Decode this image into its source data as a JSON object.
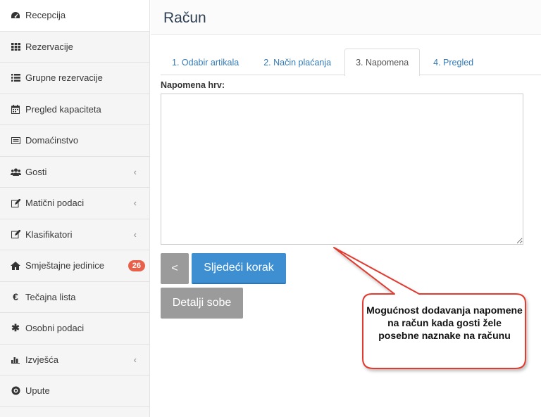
{
  "sidebar": {
    "items": [
      {
        "label": "Recepcija",
        "icon": "dashboard-icon"
      },
      {
        "label": "Rezervacije",
        "icon": "grid-icon"
      },
      {
        "label": "Grupne rezervacije",
        "icon": "list-icon"
      },
      {
        "label": "Pregled kapaciteta",
        "icon": "calendar-icon"
      },
      {
        "label": "Domaćinstvo",
        "icon": "card-icon"
      },
      {
        "label": "Gosti",
        "icon": "users-icon",
        "chevron": "‹"
      },
      {
        "label": "Matični podaci",
        "icon": "edit-icon",
        "chevron": "‹"
      },
      {
        "label": "Klasifikatori",
        "icon": "edit-icon",
        "chevron": "‹"
      },
      {
        "label": "Smještajne jedinice",
        "icon": "home-icon",
        "badge": "26"
      },
      {
        "label": "Tečajna lista",
        "icon": "euro-icon"
      },
      {
        "label": "Osobni podaci",
        "icon": "asterisk-icon"
      },
      {
        "label": "Izvješća",
        "icon": "bar-chart-icon",
        "chevron": "‹"
      },
      {
        "label": "Upute",
        "icon": "info-icon"
      }
    ]
  },
  "header": {
    "title": "Račun"
  },
  "tabs": [
    {
      "label": "1. Odabir artikala"
    },
    {
      "label": "2. Način plaćanja"
    },
    {
      "label": "3. Napomena"
    },
    {
      "label": "4. Pregled"
    }
  ],
  "form": {
    "label": "Napomena hrv:",
    "value": ""
  },
  "buttons": {
    "back": "<",
    "next": "Sljedeći korak",
    "details": "Detalji sobe"
  },
  "callout": {
    "text": "Mogućnost dodavanja napomene na račun kada gosti žele posebne naznake na računu"
  },
  "colors": {
    "accent": "#3d8fd1",
    "badge": "#e8604a",
    "callout_border": "#e03a2f"
  }
}
